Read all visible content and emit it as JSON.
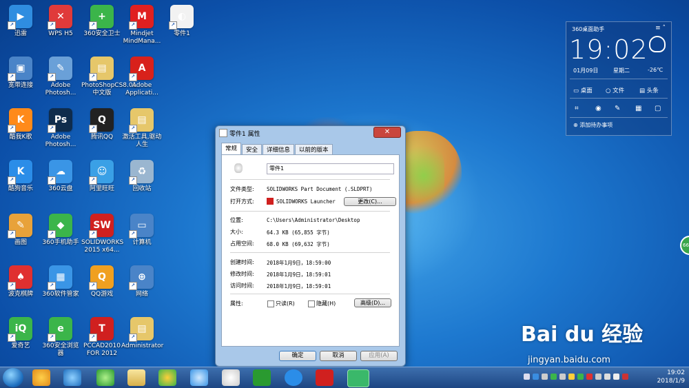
{
  "desktop_icons": [
    {
      "label": "迅雷",
      "color": "#2f8de0",
      "glyph": "▶"
    },
    {
      "label": "WPS H5",
      "color": "#e03a3a",
      "glyph": "✕"
    },
    {
      "label": "360安全卫士",
      "color": "#3bb54a",
      "glyph": "+"
    },
    {
      "label": "Mindjet MindMana...",
      "color": "#e02020",
      "glyph": "M"
    },
    {
      "label": "零件1",
      "color": "#f2f2f2",
      "glyph": "◐"
    },
    {
      "label": "宽带连接",
      "color": "#4a84c8",
      "glyph": "▣"
    },
    {
      "label": "Adobe Photosh...",
      "color": "#6aa0d8",
      "glyph": "✎"
    },
    {
      "label": "PhotoShopCS8.01中文版",
      "color": "#e6c76a",
      "glyph": "▤"
    },
    {
      "label": "Adobe Applicati...",
      "color": "#d8211b",
      "glyph": "A"
    },
    {
      "label": "酷我K歌",
      "color": "#ff8a1a",
      "glyph": "K"
    },
    {
      "label": "Adobe Photosh...",
      "color": "#0f2c4c",
      "glyph": "Ps"
    },
    {
      "label": "腾讯QQ",
      "color": "#222222",
      "glyph": "Q"
    },
    {
      "label": "激活工具,驱动人生",
      "color": "#e6c76a",
      "glyph": "▤"
    },
    {
      "label": "酷狗音乐",
      "color": "#2b8de8",
      "glyph": "K"
    },
    {
      "label": "360云盘",
      "color": "#3a95e6",
      "glyph": "☁"
    },
    {
      "label": "阿里旺旺",
      "color": "#3aa0e6",
      "glyph": "☺"
    },
    {
      "label": "回收站",
      "color": "#9ab6d0",
      "glyph": "♻"
    },
    {
      "label": "画图",
      "color": "#e8a23a",
      "glyph": "✎"
    },
    {
      "label": "360手机助手",
      "color": "#3bb54a",
      "glyph": "◆"
    },
    {
      "label": "SOLIDWORKS 2015 x64...",
      "color": "#d0201f",
      "glyph": "SW"
    },
    {
      "label": "计算机",
      "color": "#4a84c8",
      "glyph": "▭"
    },
    {
      "label": "波克棋牌",
      "color": "#e03030",
      "glyph": "♠"
    },
    {
      "label": "360软件管家",
      "color": "#3a95e6",
      "glyph": "▦"
    },
    {
      "label": "QQ游戏",
      "color": "#f0a020",
      "glyph": "Q"
    },
    {
      "label": "网络",
      "color": "#4a84c8",
      "glyph": "⊕"
    },
    {
      "label": "爱奇艺",
      "color": "#3bb54a",
      "glyph": "iQ"
    },
    {
      "label": "360安全浏览器",
      "color": "#3bb54a",
      "glyph": "e"
    },
    {
      "label": "PCCAD2010 FOR 2012",
      "color": "#d0201f",
      "glyph": "T"
    },
    {
      "label": "Administrator",
      "color": "#e6c76a",
      "glyph": "▤"
    }
  ],
  "dialog": {
    "title": "零件1 属性",
    "close": "✕",
    "tabs": [
      "常规",
      "安全",
      "详细信息",
      "以前的版本"
    ],
    "file_name": "零件1",
    "file_type_label": "文件类型:",
    "file_type_value": "SOLIDWORKS Part Document (.SLDPRT)",
    "open_with_label": "打开方式:",
    "open_with_value": "SOLIDWORKS Launcher",
    "change_button": "更改(C)...",
    "location_label": "位置:",
    "location_value": "C:\\Users\\Administrator\\Desktop",
    "size_label": "大小:",
    "size_value": "64.3 KB (65,855 字节)",
    "disk_label": "占用空间:",
    "disk_value": "68.0 KB (69,632 字节)",
    "created_label": "创建时间:",
    "created_value": "2018年1月9日，18:59:00",
    "modified_label": "修改时间:",
    "modified_value": "2018年1月9日，18:59:01",
    "accessed_label": "访问时间:",
    "accessed_value": "2018年1月9日，18:59:01",
    "attr_label": "属性:",
    "readonly_label": "只读(R)",
    "hidden_label": "隐藏(H)",
    "advanced_button": "高级(D)...",
    "ok": "确定",
    "cancel": "取消",
    "apply": "应用(A)"
  },
  "widget": {
    "title": "360桌面助手",
    "time": "19:02",
    "date": "01月09日",
    "weekday": "星期二",
    "temp": "-26℃",
    "nav": [
      "桌面",
      "文件",
      "头条"
    ],
    "todo": "添加待办事项"
  },
  "taskbar": {
    "time": "19:02",
    "date": "2018/1/9"
  },
  "watermark": {
    "brand": "Bai du 经验",
    "url": "jingyan.baidu.com"
  },
  "side_badge": "66"
}
